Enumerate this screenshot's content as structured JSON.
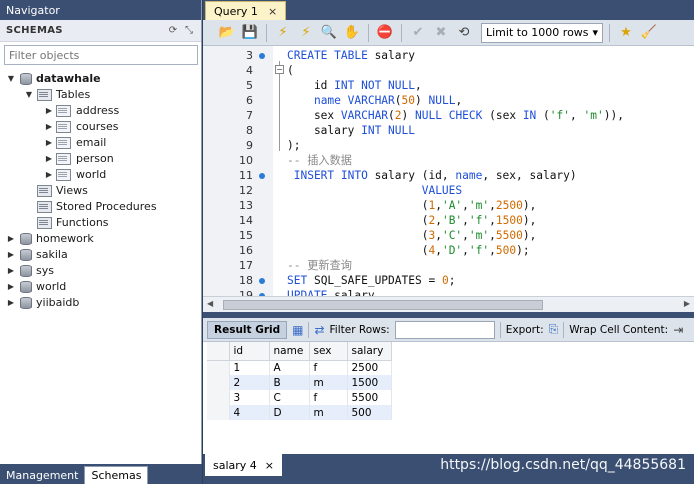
{
  "navigator": {
    "header": "Navigator",
    "schemas_title": "SCHEMAS",
    "filter_placeholder": "Filter objects",
    "active_db": "datawhale",
    "tables_label": "Tables",
    "tables": [
      "address",
      "courses",
      "email",
      "person",
      "world"
    ],
    "views_label": "Views",
    "procedures_label": "Stored Procedures",
    "functions_label": "Functions",
    "other_dbs": [
      "homework",
      "sakila",
      "sys",
      "world",
      "yiibaidb"
    ],
    "bottom_tabs": [
      "Management",
      "Schemas"
    ]
  },
  "query_tab": {
    "label": "Query 1",
    "close": "×"
  },
  "toolbar": {
    "limit_label": "Limit to 1000 rows"
  },
  "editor": {
    "lines": [
      {
        "n": "3",
        "dot": true,
        "fold": "box",
        "segs": [
          [
            "kw",
            "CREATE TABLE "
          ],
          [
            "",
            "salary"
          ]
        ]
      },
      {
        "n": "4",
        "dot": false,
        "fold": "minus",
        "segs": [
          [
            "",
            "("
          ]
        ]
      },
      {
        "n": "5",
        "dot": false,
        "fold": "",
        "segs": [
          [
            "",
            "    id "
          ],
          [
            "kw",
            "INT NOT NULL"
          ],
          [
            "",
            ","
          ]
        ]
      },
      {
        "n": "6",
        "dot": false,
        "fold": "",
        "segs": [
          [
            "",
            "    "
          ],
          [
            "kw",
            "name VARCHAR"
          ],
          [
            "",
            "("
          ],
          [
            "num",
            "50"
          ],
          [
            "",
            ") "
          ],
          [
            "kw",
            "NULL"
          ],
          [
            "",
            ","
          ]
        ]
      },
      {
        "n": "7",
        "dot": false,
        "fold": "",
        "segs": [
          [
            "",
            "    sex "
          ],
          [
            "kw",
            "VARCHAR"
          ],
          [
            "",
            "("
          ],
          [
            "num",
            "2"
          ],
          [
            "",
            ") "
          ],
          [
            "kw",
            "NULL CHECK"
          ],
          [
            "",
            " (sex "
          ],
          [
            "kw",
            "IN"
          ],
          [
            "",
            " ("
          ],
          [
            "str",
            "'f'"
          ],
          [
            "",
            ", "
          ],
          [
            "str",
            "'m'"
          ],
          [
            "",
            "))"
          ],
          [
            "",
            ","
          ]
        ]
      },
      {
        "n": "8",
        "dot": false,
        "fold": "",
        "segs": [
          [
            "",
            "    salary "
          ],
          [
            "kw",
            "INT NULL"
          ]
        ]
      },
      {
        "n": "9",
        "dot": false,
        "fold": "end",
        "segs": [
          [
            "",
            ");"
          ]
        ]
      },
      {
        "n": "10",
        "dot": false,
        "fold": "",
        "segs": [
          [
            "cmt",
            "-- 插入数据"
          ]
        ]
      },
      {
        "n": "11",
        "dot": true,
        "fold": "",
        "segs": [
          [
            "kw",
            " INSERT INTO "
          ],
          [
            "",
            "salary (id, "
          ],
          [
            "kw",
            "name"
          ],
          [
            "",
            ", sex, salary)"
          ]
        ]
      },
      {
        "n": "12",
        "dot": false,
        "fold": "",
        "segs": [
          [
            "",
            "                    "
          ],
          [
            "kw",
            "VALUES"
          ]
        ]
      },
      {
        "n": "13",
        "dot": false,
        "fold": "",
        "segs": [
          [
            "",
            "                    ("
          ],
          [
            "num",
            "1"
          ],
          [
            "",
            ","
          ],
          [
            "str",
            "'A'"
          ],
          [
            "",
            ","
          ],
          [
            "str",
            "'m'"
          ],
          [
            "",
            ","
          ],
          [
            "num",
            "2500"
          ],
          [
            "",
            "),"
          ]
        ]
      },
      {
        "n": "14",
        "dot": false,
        "fold": "",
        "segs": [
          [
            "",
            "                    ("
          ],
          [
            "num",
            "2"
          ],
          [
            "",
            ","
          ],
          [
            "str",
            "'B'"
          ],
          [
            "",
            ","
          ],
          [
            "str",
            "'f'"
          ],
          [
            "",
            ","
          ],
          [
            "num",
            "1500"
          ],
          [
            "",
            "),"
          ]
        ]
      },
      {
        "n": "15",
        "dot": false,
        "fold": "",
        "segs": [
          [
            "",
            "                    ("
          ],
          [
            "num",
            "3"
          ],
          [
            "",
            ","
          ],
          [
            "str",
            "'C'"
          ],
          [
            "",
            ","
          ],
          [
            "str",
            "'m'"
          ],
          [
            "",
            ","
          ],
          [
            "num",
            "5500"
          ],
          [
            "",
            "),"
          ]
        ]
      },
      {
        "n": "16",
        "dot": false,
        "fold": "",
        "segs": [
          [
            "",
            "                    ("
          ],
          [
            "num",
            "4"
          ],
          [
            "",
            ","
          ],
          [
            "str",
            "'D'"
          ],
          [
            "",
            ","
          ],
          [
            "str",
            "'f'"
          ],
          [
            "",
            ","
          ],
          [
            "num",
            "500"
          ],
          [
            "",
            ");"
          ]
        ]
      },
      {
        "n": "17",
        "dot": false,
        "fold": "",
        "segs": [
          [
            "cmt",
            "-- 更新查询"
          ]
        ]
      },
      {
        "n": "18",
        "dot": true,
        "fold": "",
        "segs": [
          [
            "kw",
            "SET "
          ],
          [
            "",
            "SQL_SAFE_UPDATES = "
          ],
          [
            "num",
            "0"
          ],
          [
            "",
            ";"
          ]
        ]
      },
      {
        "n": "19",
        "dot": true,
        "fold": "",
        "segs": [
          [
            "kw",
            "UPDATE "
          ],
          [
            "",
            "salary"
          ]
        ]
      }
    ]
  },
  "result_bar": {
    "result_grid": "Result Grid",
    "filter_rows": "Filter Rows:",
    "export": "Export:",
    "wrap": "Wrap Cell Content:"
  },
  "result": {
    "columns": [
      "id",
      "name",
      "sex",
      "salary"
    ],
    "rows": [
      [
        "1",
        "A",
        "f",
        "2500"
      ],
      [
        "2",
        "B",
        "m",
        "1500"
      ],
      [
        "3",
        "C",
        "f",
        "5500"
      ],
      [
        "4",
        "D",
        "m",
        "500"
      ]
    ]
  },
  "result_tab": {
    "label": "salary 4",
    "close": "×"
  },
  "watermark": "https://blog.csdn.net/qq_44855681",
  "colors": {
    "keyword": "#1f4fd8",
    "string": "#1a8a2a",
    "number": "#d06a00",
    "comment": "#8a8a8a",
    "chrome": "#3b4f72"
  }
}
